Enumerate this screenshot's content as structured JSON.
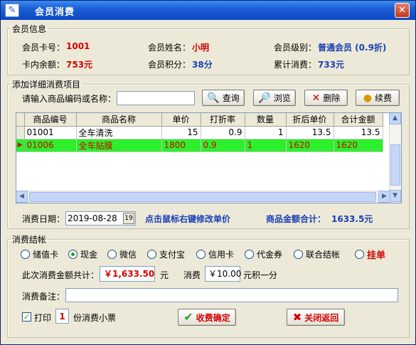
{
  "window": {
    "title": "会员消费"
  },
  "member_info": {
    "legend": "会员信息",
    "card_no_label": "会员卡号：",
    "card_no": "1001",
    "name_label": "会员姓名：",
    "name": "小明",
    "level_label": "会员级别：",
    "level": "普通会员 (0.9折)",
    "balance_label": "卡内余额：",
    "balance": "753元",
    "points_label": "会员积分：",
    "points": "38分",
    "total_label": "累计消费：",
    "total": "733元"
  },
  "items": {
    "legend": "添加详细消费项目",
    "search_label": "请输入商品编码或名称：",
    "search_value": "",
    "query_btn": "查询",
    "browse_btn": "浏览",
    "delete_btn": "删除",
    "continue_btn": "续费",
    "columns": [
      "商品编号",
      "商品名称",
      "单价",
      "打折率",
      "数量",
      "折后单价",
      "合计金额"
    ],
    "rows": [
      {
        "code": "01001",
        "name": "全车清洗",
        "price": "15",
        "rate": "0.9",
        "qty": "1",
        "disc_price": "13.5",
        "total": "13.5"
      },
      {
        "code": "01006",
        "name": "全车贴膜",
        "price": "1800",
        "rate": "0.9",
        "qty": "1",
        "disc_price": "1620",
        "total": "1620"
      }
    ],
    "date_label": "消费日期：",
    "date_value": "2019-08-28",
    "date_picker_text": "19",
    "hint": "点击鼠标右键修改单价",
    "sum_label": "商品金额合计：",
    "sum_value": "1633.5元"
  },
  "checkout": {
    "legend": "消费结帐",
    "payment_options": [
      "储值卡",
      "现金",
      "微信",
      "支付宝",
      "信用卡",
      "代金券",
      "联合结帐",
      "挂单"
    ],
    "selected_payment": "现金",
    "amount_label": "此次消费金额共计：",
    "amount_value": "￥1,633.50",
    "amount_unit": "元",
    "points_label": "消费",
    "points_rate": "￥10.00",
    "points_suffix": "元积一分",
    "remark_label": "消费备注：",
    "remark_value": "",
    "print_label": "打印",
    "print_count": "1",
    "print_suffix": "份消费小票",
    "confirm_btn": "收费确定",
    "close_btn": "关闭返回"
  },
  "colors": {
    "accent_red": "#d40000",
    "accent_blue": "#1a3fb5",
    "selected_row": "#2bf02b"
  }
}
